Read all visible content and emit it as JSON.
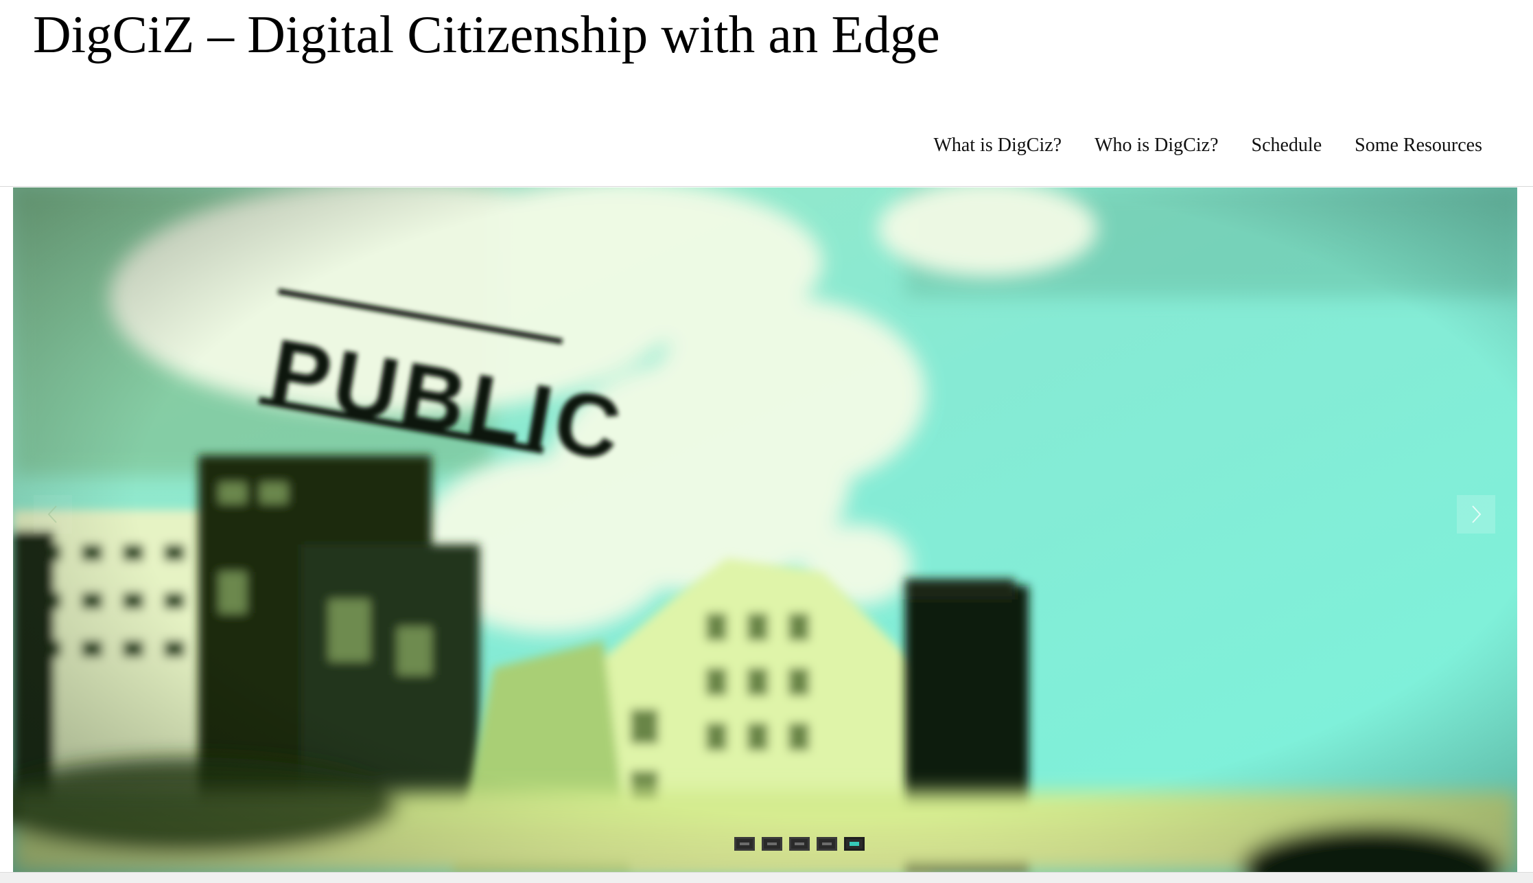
{
  "site": {
    "title": "DigCiZ – Digital Citizenship with an Edge"
  },
  "nav": {
    "items": [
      {
        "label": "What is DigCiz?"
      },
      {
        "label": "Who is DigCiz?"
      },
      {
        "label": "Schedule"
      },
      {
        "label": "Some Resources"
      }
    ]
  },
  "slider": {
    "image_icon": "city-skyline-photo",
    "prev_icon": "chevron-left-icon",
    "next_icon": "chevron-right-icon",
    "slide_count": 5,
    "active_slide": 5
  },
  "colors": {
    "sky": "#7ce8cf",
    "active_dot": "#36c9b9"
  }
}
